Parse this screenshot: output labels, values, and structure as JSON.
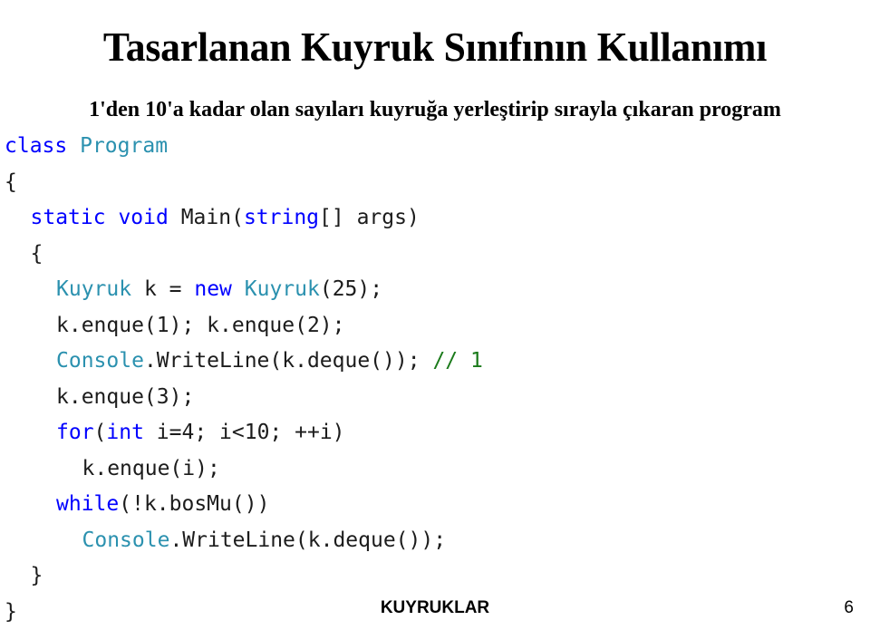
{
  "slide": {
    "title": "Tasarlanan Kuyruk Sınıfının Kullanımı",
    "subtitle": "1'den 10'a kadar olan sayıları kuyruğa yerleştirip sırayla çıkaran program",
    "background_color": "#FFFFFF"
  },
  "colors": {
    "keyword": "#0000FF",
    "type": "#2B91AF",
    "comment": "#1A7A1A",
    "plain": "#1C1C1C",
    "heading": "#000000"
  },
  "code": {
    "language": "csharp",
    "lines": [
      {
        "indent": 0,
        "tokens": [
          {
            "t": "class",
            "c": "kw"
          },
          {
            "t": " ",
            "c": "pln"
          },
          {
            "t": "Program",
            "c": "type"
          }
        ]
      },
      {
        "indent": 0,
        "tokens": [
          {
            "t": "{",
            "c": "pln"
          }
        ]
      },
      {
        "indent": 1,
        "tokens": [
          {
            "t": "static",
            "c": "kw"
          },
          {
            "t": " ",
            "c": "pln"
          },
          {
            "t": "void",
            "c": "kw"
          },
          {
            "t": " Main(",
            "c": "pln"
          },
          {
            "t": "string",
            "c": "kw"
          },
          {
            "t": "[] args)",
            "c": "pln"
          }
        ]
      },
      {
        "indent": 1,
        "tokens": [
          {
            "t": "{",
            "c": "pln"
          }
        ]
      },
      {
        "indent": 2,
        "tokens": [
          {
            "t": "Kuyruk",
            "c": "type"
          },
          {
            "t": " k = ",
            "c": "pln"
          },
          {
            "t": "new",
            "c": "kw"
          },
          {
            "t": " ",
            "c": "pln"
          },
          {
            "t": "Kuyruk",
            "c": "type"
          },
          {
            "t": "(25);",
            "c": "pln"
          }
        ]
      },
      {
        "indent": 2,
        "tokens": [
          {
            "t": "k.enque(1); k.enque(2);",
            "c": "pln"
          }
        ]
      },
      {
        "indent": 2,
        "tokens": [
          {
            "t": "Console",
            "c": "type"
          },
          {
            "t": ".WriteLine(k.deque()); ",
            "c": "pln"
          },
          {
            "t": "// 1",
            "c": "cmt"
          }
        ]
      },
      {
        "indent": 2,
        "tokens": [
          {
            "t": "k.enque(3);",
            "c": "pln"
          }
        ]
      },
      {
        "indent": 2,
        "tokens": [
          {
            "t": "for",
            "c": "kw"
          },
          {
            "t": "(",
            "c": "pln"
          },
          {
            "t": "int",
            "c": "kw"
          },
          {
            "t": " i=4; i<10; ++i)",
            "c": "pln"
          }
        ]
      },
      {
        "indent": 3,
        "tokens": [
          {
            "t": "k.enque(i);",
            "c": "pln"
          }
        ]
      },
      {
        "indent": 2,
        "tokens": [
          {
            "t": "while",
            "c": "kw"
          },
          {
            "t": "(!k.bosMu())",
            "c": "pln"
          }
        ]
      },
      {
        "indent": 3,
        "tokens": [
          {
            "t": "Console",
            "c": "type"
          },
          {
            "t": ".WriteLine(k.deque());",
            "c": "pln"
          }
        ]
      },
      {
        "indent": 1,
        "tokens": [
          {
            "t": "}",
            "c": "pln"
          }
        ]
      },
      {
        "indent": 0,
        "tokens": [
          {
            "t": "}",
            "c": "pln"
          }
        ]
      }
    ]
  },
  "footer": {
    "title": "KUYRUKLAR",
    "page_number": "6"
  }
}
